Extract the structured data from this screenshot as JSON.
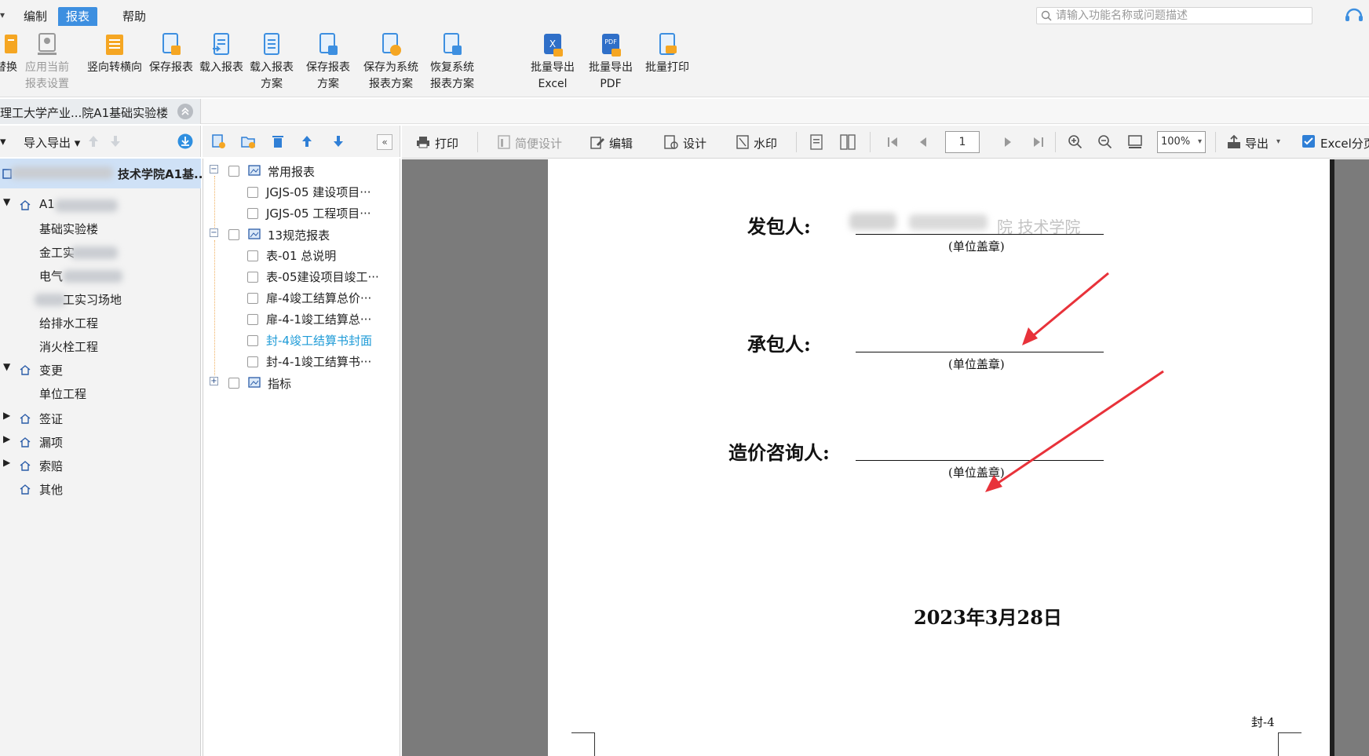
{
  "menubar": {
    "items": [
      "编制",
      "报表",
      "帮助"
    ],
    "active": "报表",
    "search_placeholder": "请输入功能名称或问题描述"
  },
  "ribbon": {
    "buttons": [
      {
        "line1": "替换",
        "line2": ""
      },
      {
        "line1": "应用当前",
        "line2": "报表设置",
        "disabled": true
      },
      {
        "line1": "竖向转横向",
        "line2": ""
      },
      {
        "line1": "保存报表",
        "line2": ""
      },
      {
        "line1": "载入报表",
        "line2": ""
      },
      {
        "line1": "载入报表",
        "line2": "方案"
      },
      {
        "line1": "保存报表",
        "line2": "方案"
      },
      {
        "line1": "保存为系统",
        "line2": "报表方案"
      },
      {
        "line1": "恢复系统",
        "line2": "报表方案"
      },
      {
        "line1": "批量导出",
        "line2": "Excel"
      },
      {
        "line1": "批量导出",
        "line2": "PDF"
      },
      {
        "line1": "批量打印",
        "line2": ""
      }
    ]
  },
  "project": {
    "title": "理工大学产业...院A1基础实验楼"
  },
  "left_toolbar": {
    "import_export": "导入导出"
  },
  "tree": {
    "root_suffix": "技术学院A1基...",
    "items": [
      {
        "label": "A1",
        "level": 1,
        "expanded": true
      },
      {
        "label": "基础实验楼",
        "level": 2
      },
      {
        "label": "金工实",
        "level": 2
      },
      {
        "label": "电气",
        "level": 2
      },
      {
        "label": "工实习场地",
        "level": 2
      },
      {
        "label": "给排水工程",
        "level": 2
      },
      {
        "label": "消火栓工程",
        "level": 2
      },
      {
        "label": "变更",
        "level": 1,
        "expanded": true
      },
      {
        "label": "单位工程",
        "level": 2
      },
      {
        "label": "签证",
        "level": 1
      },
      {
        "label": "漏项",
        "level": 1
      },
      {
        "label": "索赔",
        "level": 1
      },
      {
        "label": "其他",
        "level": 1
      }
    ]
  },
  "reports": {
    "groups": [
      {
        "label": "常用报表",
        "items": [
          "JGJS-05 建设项目···",
          "JGJS-05 工程项目···"
        ]
      },
      {
        "label": "13规范报表",
        "items": [
          "表-01 总说明",
          "表-05建设项目竣工···",
          "扉-4竣工结算总价···",
          "扉-4-1竣工结算总···",
          "封-4竣工结算书封面",
          "封-4-1竣工结算书···"
        ]
      },
      {
        "label": "指标",
        "items": []
      }
    ],
    "selected": "封-4竣工结算书封面"
  },
  "viewer_toolbar": {
    "print": "打印",
    "simple_design": "简便设计",
    "edit": "编辑",
    "design": "设计",
    "watermark": "水印",
    "page": "1",
    "zoom": "100%",
    "export": "导出",
    "excel_page": "Excel分页"
  },
  "document": {
    "employer_label": "发包人:",
    "contractor_label": "承包人:",
    "consultant_label": "造价咨询人:",
    "seal_note": "(单位盖章)",
    "date": "2023年3月28日",
    "page_code": "封-4",
    "employer_value_visible": "院 技术学院"
  },
  "colors": {
    "accent": "#3d8fe0",
    "selected_item": "#1e9bd7",
    "arrow": "#e8323a",
    "preview_bg": "#7b7b7b"
  }
}
